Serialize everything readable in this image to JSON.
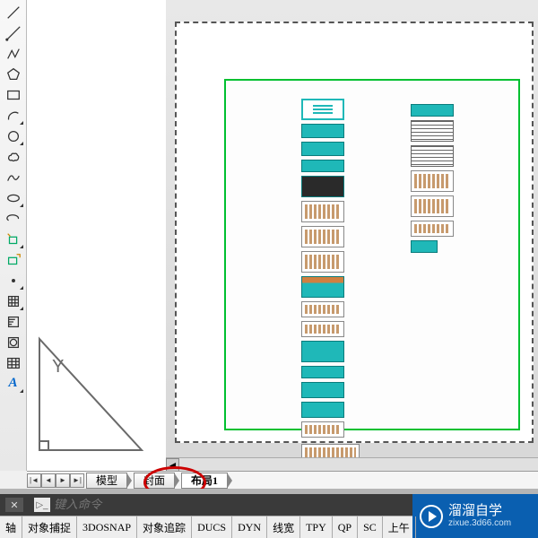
{
  "tools": [
    {
      "name": "line-icon"
    },
    {
      "name": "ray-icon"
    },
    {
      "name": "polyline-icon"
    },
    {
      "name": "polygon-icon"
    },
    {
      "name": "rectangle-icon"
    },
    {
      "name": "arc-icon"
    },
    {
      "name": "circle-icon"
    },
    {
      "name": "revcloud-icon"
    },
    {
      "name": "spline-icon"
    },
    {
      "name": "ellipse-icon"
    },
    {
      "name": "ellipse-arc-icon"
    },
    {
      "name": "block-insert-icon"
    },
    {
      "name": "make-block-icon"
    },
    {
      "name": "point-icon"
    },
    {
      "name": "hatch-icon"
    },
    {
      "name": "gradient-icon"
    },
    {
      "name": "region-icon"
    },
    {
      "name": "table-icon"
    },
    {
      "name": "mtext-icon"
    }
  ],
  "mtext_letter": "A",
  "ucs_y": "Y",
  "tabs": {
    "model": "模型",
    "cover": "封面",
    "layout1": "布局1"
  },
  "command": {
    "placeholder": "键入命令"
  },
  "badge": {
    "brand": "溜溜自学",
    "site": "zixue.3d66.com"
  },
  "status": {
    "items": [
      "轴",
      "对象捕捉",
      "3DOSNAP",
      "对象追踪",
      "DUCS",
      "DYN",
      "线宽",
      "TPY",
      "QP",
      "SC",
      "上午"
    ]
  }
}
